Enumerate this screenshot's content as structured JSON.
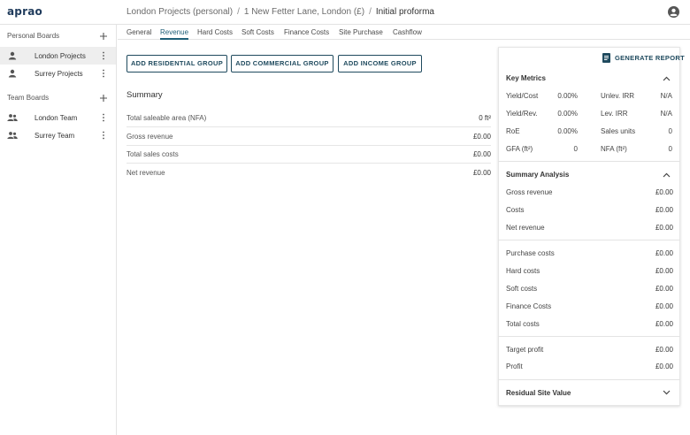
{
  "app": {
    "logo": "aprao"
  },
  "breadcrumb": [
    "London Projects (personal)",
    "1 New Fetter Lane, London (£)",
    "Initial proforma"
  ],
  "sidebar": {
    "personal_heading": "Personal Boards",
    "personal_items": [
      {
        "label": "London Projects",
        "active": true
      },
      {
        "label": "Surrey Projects",
        "active": false
      }
    ],
    "team_heading": "Team Boards",
    "team_items": [
      {
        "label": "London Team"
      },
      {
        "label": "Surrey Team"
      }
    ]
  },
  "tabs": [
    {
      "label": "General",
      "active": false
    },
    {
      "label": "Revenue",
      "active": true
    },
    {
      "label": "Hard Costs",
      "active": false
    },
    {
      "label": "Soft Costs",
      "active": false
    },
    {
      "label": "Finance Costs",
      "active": false
    },
    {
      "label": "Site Purchase",
      "active": false
    },
    {
      "label": "Cashflow",
      "active": false
    }
  ],
  "actions": {
    "add_residential": "ADD RESIDENTIAL GROUP",
    "add_commercial": "ADD COMMERCIAL GROUP",
    "add_income": "ADD INCOME GROUP"
  },
  "summary": {
    "title": "Summary",
    "rows": [
      {
        "label": "Total saleable area (NFA)",
        "value": "0 ft²"
      },
      {
        "label": "Gross revenue",
        "value": "£0.00"
      },
      {
        "label": "Total sales costs",
        "value": "£0.00"
      },
      {
        "label": "Net revenue",
        "value": "£0.00"
      }
    ]
  },
  "panel": {
    "generate_report": "GENERATE REPORT",
    "key_metrics": {
      "title": "Key Metrics",
      "rows": [
        {
          "k1": "Yield/Cost",
          "v1": "0.00%",
          "k2": "Unlev. IRR",
          "v2": "N/A"
        },
        {
          "k1": "Yield/Rev.",
          "v1": "0.00%",
          "k2": "Lev. IRR",
          "v2": "N/A"
        },
        {
          "k1": "RoE",
          "v1": "0.00%",
          "k2": "Sales units",
          "v2": "0"
        },
        {
          "k1": "GFA (ft²)",
          "v1": "0",
          "k2": "NFA (ft²)",
          "v2": "0"
        }
      ]
    },
    "summary_analysis": {
      "title": "Summary Analysis",
      "group1": [
        {
          "label": "Gross revenue",
          "value": "£0.00"
        },
        {
          "label": "Costs",
          "value": "£0.00"
        },
        {
          "label": "Net revenue",
          "value": "£0.00"
        }
      ],
      "group2": [
        {
          "label": "Purchase costs",
          "value": "£0.00"
        },
        {
          "label": "Hard costs",
          "value": "£0.00"
        },
        {
          "label": "Soft costs",
          "value": "£0.00"
        },
        {
          "label": "Finance Costs",
          "value": "£0.00"
        },
        {
          "label": "Total costs",
          "value": "£0.00"
        }
      ],
      "group3": [
        {
          "label": "Target profit",
          "value": "£0.00"
        },
        {
          "label": "Profit",
          "value": "£0.00"
        }
      ]
    },
    "residual": {
      "title": "Residual Site Value"
    }
  },
  "colors": {
    "accent": "#1f5f78",
    "brand": "#1f3b5c",
    "active_row": "#eeeeee"
  }
}
